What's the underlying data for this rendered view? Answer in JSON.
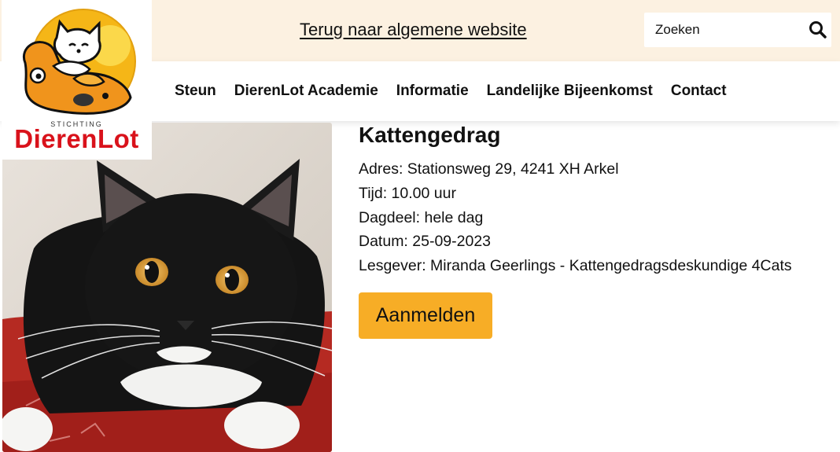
{
  "header": {
    "back_link": "Terug naar algemene website",
    "search": {
      "placeholder": "Zoeken"
    }
  },
  "logo": {
    "small_text": "STICHTING",
    "name": "DierenLot"
  },
  "nav": {
    "items": [
      {
        "label": "Steun"
      },
      {
        "label": "DierenLot Academie"
      },
      {
        "label": "Informatie"
      },
      {
        "label": "Landelijke Bijeenkomst"
      },
      {
        "label": "Contact"
      }
    ]
  },
  "event": {
    "title": "Kattengedrag",
    "address": "Adres: Stationsweg 29, 4241 XH Arkel",
    "time": "Tijd: 10.00 uur",
    "daypart": "Dagdeel: hele dag",
    "date": "Datum: 25-09-2023",
    "teacher": "Lesgever: Miranda Geerlings - Kattengedragsdeskundige 4Cats",
    "register_label": "Aanmelden"
  },
  "colors": {
    "topbar_bg": "#fcf1e1",
    "brand_red": "#d9121b",
    "cta_orange": "#f7ad26",
    "logo_yellow": "#f5b617"
  },
  "icons": {
    "search": "magnifier",
    "logo": "cat-and-dog-illustration"
  }
}
